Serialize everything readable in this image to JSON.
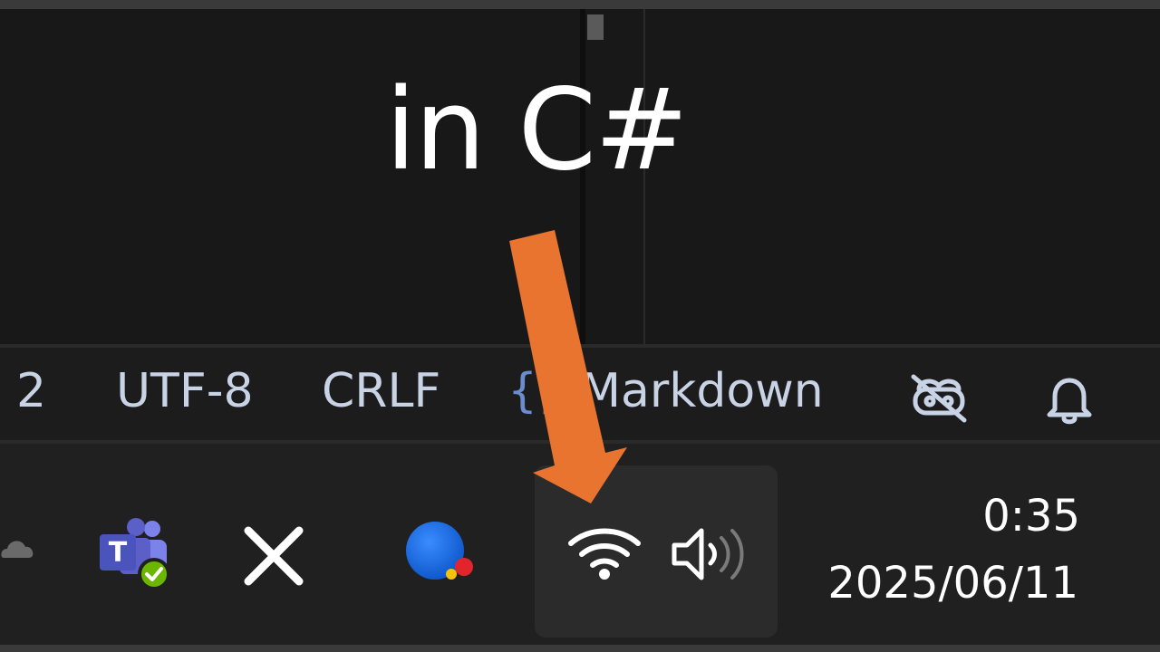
{
  "caption": {
    "text": "in C#"
  },
  "statusbar": {
    "column_prefix": ":",
    "column_value": " 2",
    "encoding": "UTF-8",
    "line_ending": "CRLF",
    "language_braces": "{}",
    "language": "Markdown",
    "icons": [
      "copilot-off-icon",
      "notification-bell-icon"
    ]
  },
  "taskbar": {
    "tray_icons": [
      "onedrive-cloud-icon",
      "teams-icon",
      "x-app-icon",
      "copilot-ball-icon"
    ],
    "network_icon": "wifi-icon",
    "volume_icon": "speaker-volume-icon",
    "clock": {
      "time": "0:35",
      "date": "2025/06/11"
    }
  },
  "colors": {
    "arrow": "#e8742f",
    "statusbar_text": "#c9d3e6",
    "accent_blue": "#1e6fd9",
    "teams_purple": "#5b5fc7"
  }
}
